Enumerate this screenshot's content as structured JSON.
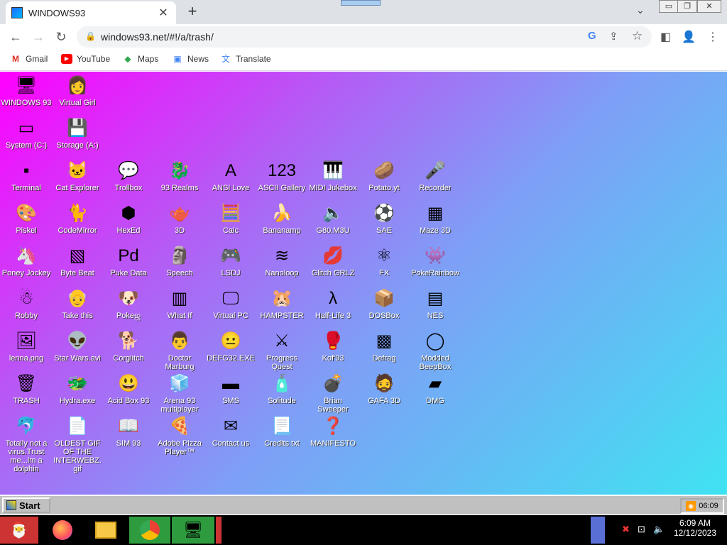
{
  "browser": {
    "tab_title": "WINDOWS93",
    "tab_close": "✕",
    "new_tab": "+",
    "url": "windows93.net/#!/a/trash/",
    "bookmarks": [
      "Gmail",
      "YouTube",
      "Maps",
      "News",
      "Translate"
    ]
  },
  "desktop": {
    "icons": [
      {
        "label": "WINDOWS 93",
        "glyph": "🖥"
      },
      {
        "label": "Virtual Girl",
        "glyph": "👩"
      },
      {
        "label": "System (C:)",
        "glyph": "▭"
      },
      {
        "label": "Storage (A:)",
        "glyph": "💾"
      },
      {
        "label": "Terminal",
        "glyph": "▪"
      },
      {
        "label": "Cat Explorer",
        "glyph": "🐱"
      },
      {
        "label": "Trollbox",
        "glyph": "💬"
      },
      {
        "label": "93 Realms",
        "glyph": "🐉"
      },
      {
        "label": "ANSI Love",
        "glyph": "A"
      },
      {
        "label": "ASCII Gallery",
        "glyph": "123"
      },
      {
        "label": "MIDI Jukebox",
        "glyph": "🎹"
      },
      {
        "label": "Potato.yt",
        "glyph": "🥔"
      },
      {
        "label": "Recorder",
        "glyph": "🎤"
      },
      {
        "label": "Piskel",
        "glyph": "🎨"
      },
      {
        "label": "CodeMirror",
        "glyph": "🐈"
      },
      {
        "label": "HexEd",
        "glyph": "⬢"
      },
      {
        "label": "3D",
        "glyph": "🫖"
      },
      {
        "label": "Calc",
        "glyph": "🧮"
      },
      {
        "label": "Bananamp",
        "glyph": "🍌"
      },
      {
        "label": "G80.M3U",
        "glyph": "🔈"
      },
      {
        "label": "SAE",
        "glyph": "⚽"
      },
      {
        "label": "Maze 3D",
        "glyph": "▦"
      },
      {
        "label": "Poney Jockey",
        "glyph": "🦄"
      },
      {
        "label": "Byte Beat",
        "glyph": "▧"
      },
      {
        "label": "Puke Data",
        "glyph": "Pd"
      },
      {
        "label": "Speech",
        "glyph": "🗿"
      },
      {
        "label": "LSDJ",
        "glyph": "🎮"
      },
      {
        "label": "Nanoloop",
        "glyph": "≋"
      },
      {
        "label": "Glitch GRLZ",
        "glyph": "💋"
      },
      {
        "label": "FX",
        "glyph": "⚛"
      },
      {
        "label": "PokeRainbow",
        "glyph": "👾"
      },
      {
        "label": "Robby",
        "glyph": "☃"
      },
      {
        "label": "Take this",
        "glyph": "👴"
      },
      {
        "label": "Pokeஜ",
        "glyph": "🐶"
      },
      {
        "label": "What If",
        "glyph": "▥"
      },
      {
        "label": "Virtual PC",
        "glyph": "🖵"
      },
      {
        "label": "HAMPSTER",
        "glyph": "🐹"
      },
      {
        "label": "Half-Life 3",
        "glyph": "λ"
      },
      {
        "label": "DOSBox",
        "glyph": "📦"
      },
      {
        "label": "NES",
        "glyph": "▤"
      },
      {
        "label": "lenna.png",
        "glyph": "🖼"
      },
      {
        "label": "Star Wars.avi",
        "glyph": "👽"
      },
      {
        "label": "Corglitch",
        "glyph": "🐕"
      },
      {
        "label": "Doctor Marburg",
        "glyph": "👨"
      },
      {
        "label": "DEFG32.EXE",
        "glyph": "😐"
      },
      {
        "label": "Progress Quest",
        "glyph": "⚔"
      },
      {
        "label": "Kof'93",
        "glyph": "🥊"
      },
      {
        "label": "Defrag",
        "glyph": "▩"
      },
      {
        "label": "Modded BeepBox",
        "glyph": "◯"
      },
      {
        "label": "TRASH",
        "glyph": "🗑"
      },
      {
        "label": "Hydra.exe",
        "glyph": "🐲"
      },
      {
        "label": "Acid Box 93",
        "glyph": "😃"
      },
      {
        "label": "Arena 93 multiplayer",
        "glyph": "🧊"
      },
      {
        "label": "SMS",
        "glyph": "▬"
      },
      {
        "label": "Solitude",
        "glyph": "🧴"
      },
      {
        "label": "Brian Sweeper",
        "glyph": "💣"
      },
      {
        "label": "GAFA 3D",
        "glyph": "🧔"
      },
      {
        "label": "DMG",
        "glyph": "▰"
      },
      {
        "label": "Totally not a virus.Trust me...im a dolphin",
        "glyph": "🐬"
      },
      {
        "label": "OLDEST GIF OF THE INTERWEBZ.gif",
        "glyph": "📄"
      },
      {
        "label": "SIM 93",
        "glyph": "📖"
      },
      {
        "label": "Adobe Pizza Player™",
        "glyph": "🍕"
      },
      {
        "label": "Contact us",
        "glyph": "✉"
      },
      {
        "label": "Credits.txt",
        "glyph": "📃"
      },
      {
        "label": "MANIFESTO",
        "glyph": "❓"
      }
    ]
  },
  "w93taskbar": {
    "start_label": "Start",
    "tray_time": "06:09"
  },
  "wintaskbar": {
    "time": "6:09 AM",
    "date": "12/12/2023"
  }
}
